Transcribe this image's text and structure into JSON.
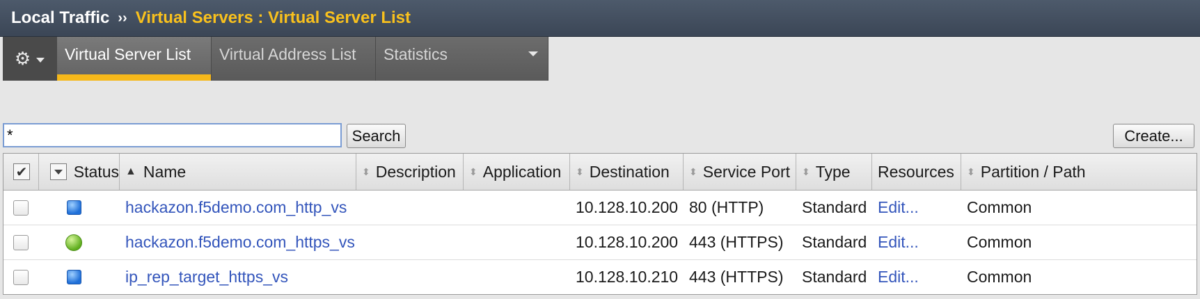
{
  "breadcrumb": {
    "root": "Local Traffic",
    "separator": "››",
    "current": "Virtual Servers : Virtual Server List"
  },
  "tabs": [
    {
      "label": "Virtual Server List",
      "active": true
    },
    {
      "label": "Virtual Address List",
      "active": false
    },
    {
      "label": "Statistics",
      "active": false
    }
  ],
  "icons": {
    "gear": "gear-icon",
    "status_blue": "status-unknown-blue-square",
    "status_green": "status-available-green-circle"
  },
  "search": {
    "value": "*",
    "button_label": "Search"
  },
  "create_label": "Create...",
  "table": {
    "columns": [
      "Status",
      "Name",
      "Description",
      "Application",
      "Destination",
      "Service Port",
      "Type",
      "Resources",
      "Partition / Path"
    ],
    "rows": [
      {
        "status": "blue",
        "name": "hackazon.f5demo.com_http_vs",
        "description": "",
        "application": "",
        "destination": "10.128.10.200",
        "service_port": "80 (HTTP)",
        "type": "Standard",
        "resources": "Edit...",
        "partition": "Common"
      },
      {
        "status": "green",
        "name": "hackazon.f5demo.com_https_vs",
        "description": "",
        "application": "",
        "destination": "10.128.10.200",
        "service_port": "443 (HTTPS)",
        "type": "Standard",
        "resources": "Edit...",
        "partition": "Common"
      },
      {
        "status": "blue",
        "name": "ip_rep_target_https_vs",
        "description": "",
        "application": "",
        "destination": "10.128.10.210",
        "service_port": "443 (HTTPS)",
        "type": "Standard",
        "resources": "Edit...",
        "partition": "Common"
      }
    ]
  },
  "colors": {
    "accent": "#f6b81a",
    "header_bg": "#43505f",
    "link": "#3355bb"
  }
}
